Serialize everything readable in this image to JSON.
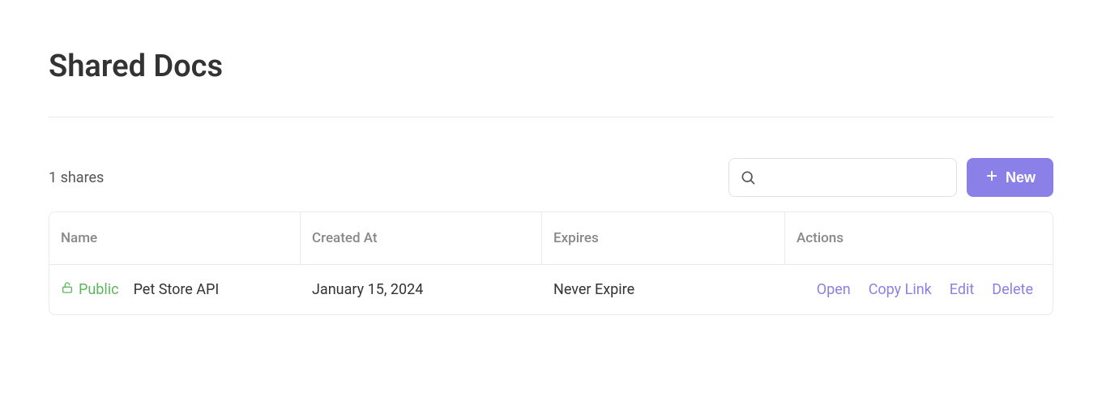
{
  "page": {
    "title": "Shared Docs",
    "shares_count_label": "1 shares"
  },
  "toolbar": {
    "search_placeholder": "",
    "new_button_label": "New"
  },
  "table": {
    "headers": {
      "name": "Name",
      "created_at": "Created At",
      "expires": "Expires",
      "actions": "Actions"
    },
    "rows": [
      {
        "visibility_label": "Public",
        "name": "Pet Store API",
        "created_at": "January 15, 2024",
        "expires": "Never Expire",
        "actions": {
          "open": "Open",
          "copy_link": "Copy Link",
          "edit": "Edit",
          "delete": "Delete"
        }
      }
    ]
  }
}
